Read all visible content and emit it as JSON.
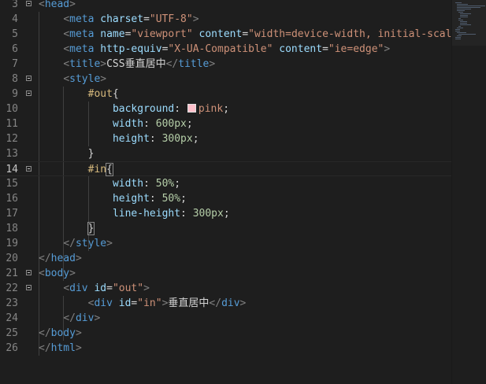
{
  "editor": {
    "lines": [
      {
        "num": "3",
        "current": false,
        "fold": true,
        "indent": 0,
        "tokens": [
          [
            "<",
            "pun"
          ],
          [
            "head",
            "tag"
          ],
          [
            ">",
            "pun"
          ]
        ]
      },
      {
        "num": "4",
        "current": false,
        "fold": false,
        "indent": 1,
        "tokens": [
          [
            "<",
            "pun"
          ],
          [
            "meta",
            "tag"
          ],
          [
            " ",
            "txt"
          ],
          [
            "charset",
            "attr"
          ],
          [
            "=",
            "txt"
          ],
          [
            "\"UTF-8\"",
            "str"
          ],
          [
            ">",
            "pun"
          ]
        ]
      },
      {
        "num": "5",
        "current": false,
        "fold": false,
        "indent": 1,
        "tokens": [
          [
            "<",
            "pun"
          ],
          [
            "meta",
            "tag"
          ],
          [
            " ",
            "txt"
          ],
          [
            "name",
            "attr"
          ],
          [
            "=",
            "txt"
          ],
          [
            "\"viewport\"",
            "str"
          ],
          [
            " ",
            "txt"
          ],
          [
            "content",
            "attr"
          ],
          [
            "=",
            "txt"
          ],
          [
            "\"width=device-width, initial-scale",
            "str"
          ]
        ]
      },
      {
        "num": "6",
        "current": false,
        "fold": false,
        "indent": 1,
        "tokens": [
          [
            "<",
            "pun"
          ],
          [
            "meta",
            "tag"
          ],
          [
            " ",
            "txt"
          ],
          [
            "http-equiv",
            "attr"
          ],
          [
            "=",
            "txt"
          ],
          [
            "\"X-UA-Compatible\"",
            "str"
          ],
          [
            " ",
            "txt"
          ],
          [
            "content",
            "attr"
          ],
          [
            "=",
            "txt"
          ],
          [
            "\"ie=edge\"",
            "str"
          ],
          [
            ">",
            "pun"
          ]
        ]
      },
      {
        "num": "7",
        "current": false,
        "fold": false,
        "indent": 1,
        "tokens": [
          [
            "<",
            "pun"
          ],
          [
            "title",
            "tag"
          ],
          [
            ">",
            "pun"
          ],
          [
            "CSS垂直居中",
            "txt"
          ],
          [
            "</",
            "pun"
          ],
          [
            "title",
            "tag"
          ],
          [
            ">",
            "pun"
          ]
        ]
      },
      {
        "num": "8",
        "current": false,
        "fold": true,
        "indent": 1,
        "tokens": [
          [
            "<",
            "pun"
          ],
          [
            "style",
            "tag"
          ],
          [
            ">",
            "pun"
          ]
        ]
      },
      {
        "num": "9",
        "current": false,
        "fold": true,
        "indent": 2,
        "tokens": [
          [
            "#out",
            "sel"
          ],
          [
            "{",
            "txt"
          ]
        ]
      },
      {
        "num": "10",
        "current": false,
        "fold": false,
        "indent": 3,
        "tokens": [
          [
            "background",
            "prop"
          ],
          [
            ": ",
            "txt"
          ],
          [
            "",
            "swatch"
          ],
          [
            "pink",
            "val"
          ],
          [
            ";",
            "txt"
          ]
        ]
      },
      {
        "num": "11",
        "current": false,
        "fold": false,
        "indent": 3,
        "tokens": [
          [
            "width",
            "prop"
          ],
          [
            ": ",
            "txt"
          ],
          [
            "600px",
            "num"
          ],
          [
            ";",
            "txt"
          ]
        ]
      },
      {
        "num": "12",
        "current": false,
        "fold": false,
        "indent": 3,
        "tokens": [
          [
            "height",
            "prop"
          ],
          [
            ": ",
            "txt"
          ],
          [
            "300px",
            "num"
          ],
          [
            ";",
            "txt"
          ]
        ]
      },
      {
        "num": "13",
        "current": false,
        "fold": false,
        "indent": 2,
        "tokens": [
          [
            "}",
            "txt"
          ]
        ]
      },
      {
        "num": "14",
        "current": true,
        "fold": true,
        "indent": 2,
        "tokens": [
          [
            "#in",
            "sel"
          ],
          [
            "{",
            "brace"
          ]
        ]
      },
      {
        "num": "15",
        "current": false,
        "fold": false,
        "indent": 3,
        "tokens": [
          [
            "width",
            "prop"
          ],
          [
            ": ",
            "txt"
          ],
          [
            "50%",
            "num"
          ],
          [
            ";",
            "txt"
          ]
        ]
      },
      {
        "num": "16",
        "current": false,
        "fold": false,
        "indent": 3,
        "tokens": [
          [
            "height",
            "prop"
          ],
          [
            ": ",
            "txt"
          ],
          [
            "50%",
            "num"
          ],
          [
            ";",
            "txt"
          ]
        ]
      },
      {
        "num": "17",
        "current": false,
        "fold": false,
        "indent": 3,
        "tokens": [
          [
            "line-height",
            "prop"
          ],
          [
            ": ",
            "txt"
          ],
          [
            "300px",
            "num"
          ],
          [
            ";",
            "txt"
          ]
        ]
      },
      {
        "num": "18",
        "current": false,
        "fold": false,
        "indent": 2,
        "tokens": [
          [
            "}",
            "brace"
          ]
        ]
      },
      {
        "num": "19",
        "current": false,
        "fold": false,
        "indent": 1,
        "tokens": [
          [
            "</",
            "pun"
          ],
          [
            "style",
            "tag"
          ],
          [
            ">",
            "pun"
          ]
        ]
      },
      {
        "num": "20",
        "current": false,
        "fold": false,
        "indent": 0,
        "tokens": [
          [
            "</",
            "pun"
          ],
          [
            "head",
            "tag"
          ],
          [
            ">",
            "pun"
          ]
        ]
      },
      {
        "num": "21",
        "current": false,
        "fold": true,
        "indent": 0,
        "tokens": [
          [
            "<",
            "pun"
          ],
          [
            "body",
            "tag"
          ],
          [
            ">",
            "pun"
          ]
        ]
      },
      {
        "num": "22",
        "current": false,
        "fold": true,
        "indent": 1,
        "tokens": [
          [
            "<",
            "pun"
          ],
          [
            "div",
            "tag"
          ],
          [
            " ",
            "txt"
          ],
          [
            "id",
            "attr"
          ],
          [
            "=",
            "txt"
          ],
          [
            "\"out\"",
            "str"
          ],
          [
            ">",
            "pun"
          ]
        ]
      },
      {
        "num": "23",
        "current": false,
        "fold": false,
        "indent": 2,
        "tokens": [
          [
            "<",
            "pun"
          ],
          [
            "div",
            "tag"
          ],
          [
            " ",
            "txt"
          ],
          [
            "id",
            "attr"
          ],
          [
            "=",
            "txt"
          ],
          [
            "\"in\"",
            "str"
          ],
          [
            ">",
            "pun"
          ],
          [
            "垂直居中",
            "txt"
          ],
          [
            "</",
            "pun"
          ],
          [
            "div",
            "tag"
          ],
          [
            ">",
            "pun"
          ]
        ]
      },
      {
        "num": "24",
        "current": false,
        "fold": false,
        "indent": 1,
        "tokens": [
          [
            "</",
            "pun"
          ],
          [
            "div",
            "tag"
          ],
          [
            ">",
            "pun"
          ]
        ]
      },
      {
        "num": "25",
        "current": false,
        "fold": false,
        "indent": 0,
        "tokens": [
          [
            "</",
            "pun"
          ],
          [
            "body",
            "tag"
          ],
          [
            ">",
            "pun"
          ]
        ]
      },
      {
        "num": "26",
        "current": false,
        "fold": false,
        "indent": 0,
        "tokens": [
          [
            "</",
            "pun"
          ],
          [
            "html",
            "tag"
          ],
          [
            ">",
            "pun"
          ]
        ]
      }
    ]
  },
  "theme": {
    "background": "#1e1e1e",
    "tag_color": "#569cd6",
    "attr_color": "#9cdcfe",
    "string_color": "#ce9178",
    "selector_color": "#d7ba7d",
    "number_color": "#b5cea8",
    "swatch_color": "#ffc0cb"
  }
}
